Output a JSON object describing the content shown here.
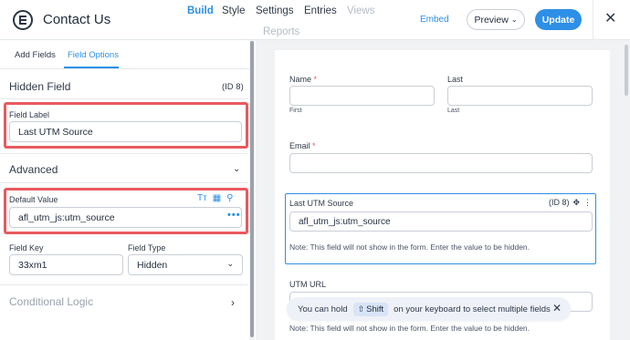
{
  "header": {
    "form_title": "Contact Us",
    "nav": [
      {
        "label": "Build",
        "state": "active"
      },
      {
        "label": "Style",
        "state": "normal"
      },
      {
        "label": "Settings",
        "state": "normal"
      },
      {
        "label": "Entries",
        "state": "normal"
      },
      {
        "label": "Views",
        "state": "disabled"
      },
      {
        "label": "Reports",
        "state": "disabled"
      }
    ],
    "embed_label": "Embed",
    "preview_label": "Preview",
    "update_label": "Update",
    "close_icon": "close-icon"
  },
  "sidebar": {
    "tabs": [
      {
        "label": "Add Fields",
        "active": false
      },
      {
        "label": "Field Options",
        "active": true
      }
    ],
    "field_type_title": "Hidden Field",
    "field_id": "(ID 8)",
    "field_label_caption": "Field Label",
    "field_label_value": "Last UTM Source",
    "advanced_title": "Advanced",
    "default_value_caption": "Default Value",
    "default_value": "afl_utm_js:utm_source",
    "field_key_caption": "Field Key",
    "field_key_value": "33xm1",
    "field_type_caption": "Field Type",
    "field_type_value": "Hidden",
    "conditional_logic_title": "Conditional Logic"
  },
  "canvas": {
    "name_label": "Name",
    "first_sublabel": "First",
    "last_label": "Last",
    "last_sublabel": "Last",
    "email_label": "Email",
    "required_marker": "*",
    "hidden_field_label": "Last UTM Source",
    "hidden_field_id": "(ID 8)",
    "hidden_field_value": "afl_utm_js:utm_source",
    "hidden_note": "Note: This field will not show in the form. Enter the value to be hidden.",
    "utm_url_label": "UTM URL",
    "utm_url_note": "Note: This field will not show in the form. Enter the value to be hidden."
  },
  "tooltip": {
    "text_before": "You can hold",
    "key": "Shift",
    "text_after": "on your keyboard to select multiple fields"
  },
  "colors": {
    "accent": "#2d8fe6",
    "highlight_border": "#e85a5f",
    "required": "#e85a5f"
  }
}
